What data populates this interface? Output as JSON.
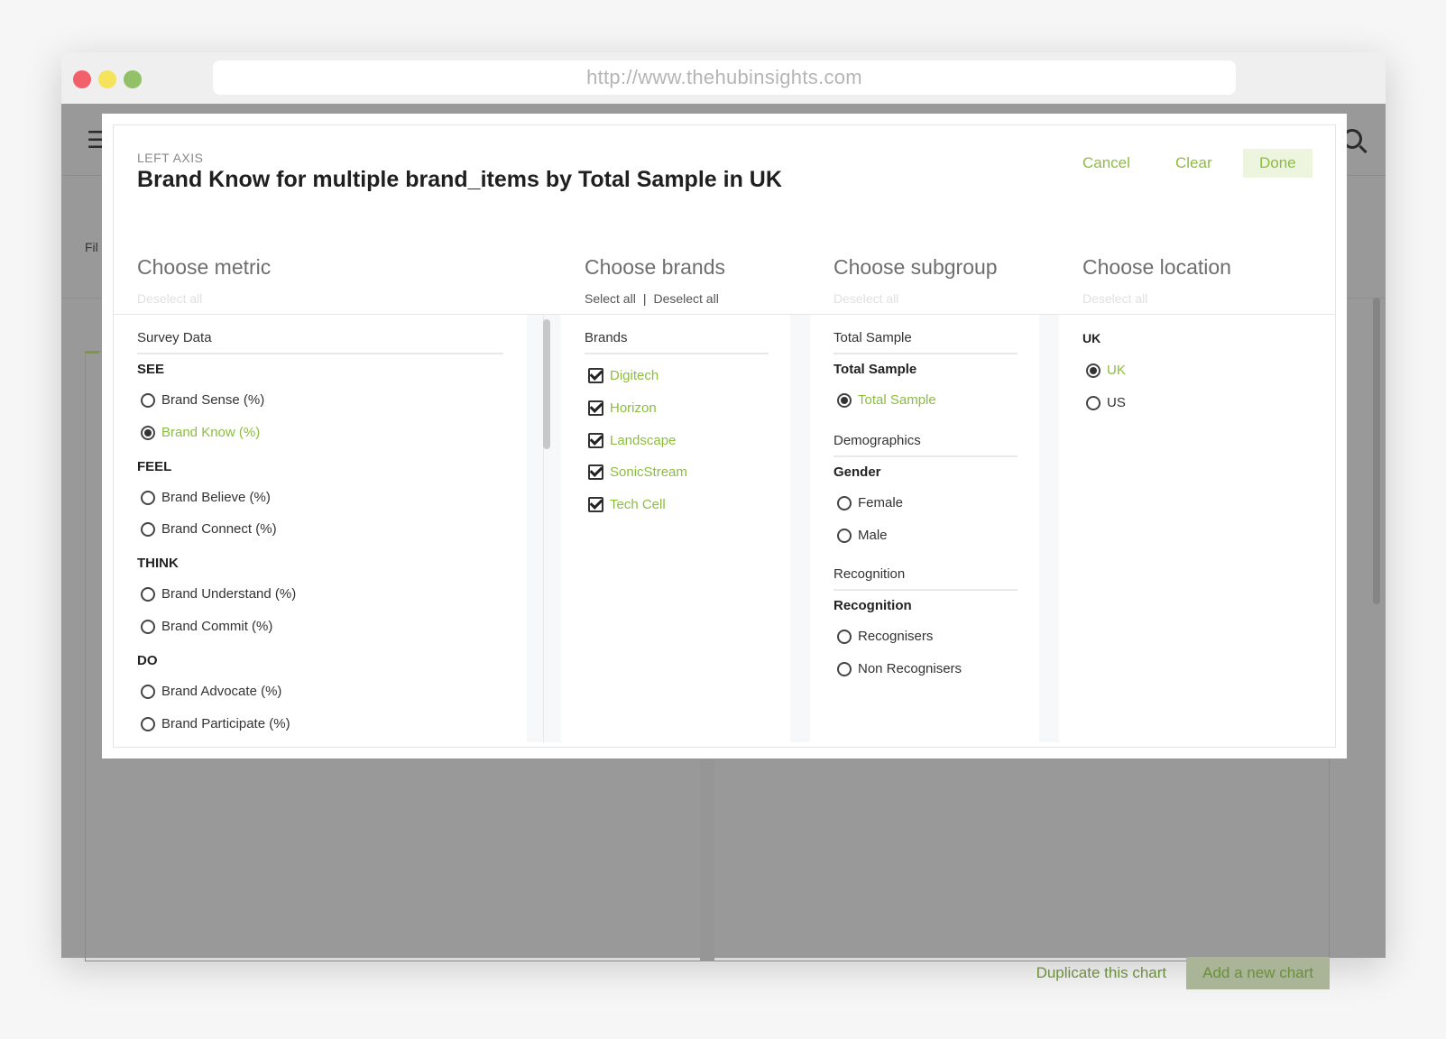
{
  "browser": {
    "url": "http://www.thehubinsights.com"
  },
  "background_app": {
    "filter_label": "Fil",
    "menu_icon": "hamburger-menu-icon",
    "search_icon": "search-icon",
    "duplicate_label": "Duplicate this chart",
    "add_label": "Add a new chart"
  },
  "modal": {
    "axis_label": "LEFT AXIS",
    "title": "Brand Know for multiple brand_items by Total Sample in UK",
    "cancel": "Cancel",
    "clear": "Clear",
    "done": "Done"
  },
  "metric": {
    "heading": "Choose metric",
    "deselect": "Deselect all",
    "group": "Survey Data",
    "sections": [
      {
        "title": "SEE",
        "options": [
          {
            "label": "Brand Sense (%)",
            "selected": false
          },
          {
            "label": "Brand Know (%)",
            "selected": true
          }
        ]
      },
      {
        "title": "FEEL",
        "options": [
          {
            "label": "Brand Believe (%)",
            "selected": false
          },
          {
            "label": "Brand Connect (%)",
            "selected": false
          }
        ]
      },
      {
        "title": "THINK",
        "options": [
          {
            "label": "Brand Understand (%)",
            "selected": false
          },
          {
            "label": "Brand Commit (%)",
            "selected": false
          }
        ]
      },
      {
        "title": "DO",
        "options": [
          {
            "label": "Brand Advocate (%)",
            "selected": false
          },
          {
            "label": "Brand Participate (%)",
            "selected": false
          }
        ]
      }
    ]
  },
  "brands": {
    "heading": "Choose brands",
    "select_all": "Select all",
    "deselect": "Deselect all",
    "group": "Brands",
    "items": [
      {
        "label": "Digitech",
        "checked": true
      },
      {
        "label": "Horizon",
        "checked": true
      },
      {
        "label": "Landscape",
        "checked": true
      },
      {
        "label": "SonicStream",
        "checked": true
      },
      {
        "label": "Tech Cell",
        "checked": true
      }
    ]
  },
  "subgroup": {
    "heading": "Choose subgroup",
    "deselect": "Deselect all",
    "groups": [
      {
        "group": "Total Sample",
        "section": "Total Sample",
        "options": [
          {
            "label": "Total Sample",
            "selected": true
          }
        ]
      },
      {
        "group": "Demographics",
        "section": "Gender",
        "options": [
          {
            "label": "Female",
            "selected": false
          },
          {
            "label": "Male",
            "selected": false
          }
        ]
      },
      {
        "group": "Recognition",
        "section": "Recognition",
        "options": [
          {
            "label": "Recognisers",
            "selected": false
          },
          {
            "label": "Non Recognisers",
            "selected": false
          }
        ]
      }
    ]
  },
  "location": {
    "heading": "Choose location",
    "deselect": "Deselect all",
    "section": "UK",
    "options": [
      {
        "label": "UK",
        "selected": true
      },
      {
        "label": "US",
        "selected": false
      }
    ]
  },
  "colors": {
    "accent": "#8cbd3f",
    "overlay": "#999999"
  }
}
